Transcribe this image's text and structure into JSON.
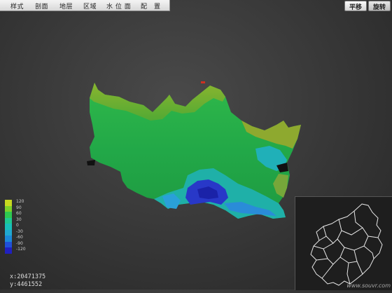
{
  "menu": {
    "items": [
      "样式",
      "剖面",
      "地层",
      "区域",
      "水 位 面",
      "配　置"
    ]
  },
  "mode_buttons": [
    {
      "label": "平移",
      "active": false
    },
    {
      "label": "旋转",
      "active": true
    }
  ],
  "legend": {
    "entries": [
      {
        "label": "120",
        "color": "#c8d820"
      },
      {
        "label": "90",
        "color": "#7ccf2a"
      },
      {
        "label": "60",
        "color": "#2ec850"
      },
      {
        "label": "30",
        "color": "#1fc890"
      },
      {
        "label": "0",
        "color": "#18c0b8"
      },
      {
        "label": "-30",
        "color": "#20a8d0"
      },
      {
        "label": "-60",
        "color": "#1c88d8"
      },
      {
        "label": "-90",
        "color": "#2050d8"
      },
      {
        "label": "-120",
        "color": "#2020c0"
      }
    ]
  },
  "coordinates": {
    "x": "x:20471375",
    "y": "y:4461552"
  },
  "watermark": "www.souvr.com"
}
